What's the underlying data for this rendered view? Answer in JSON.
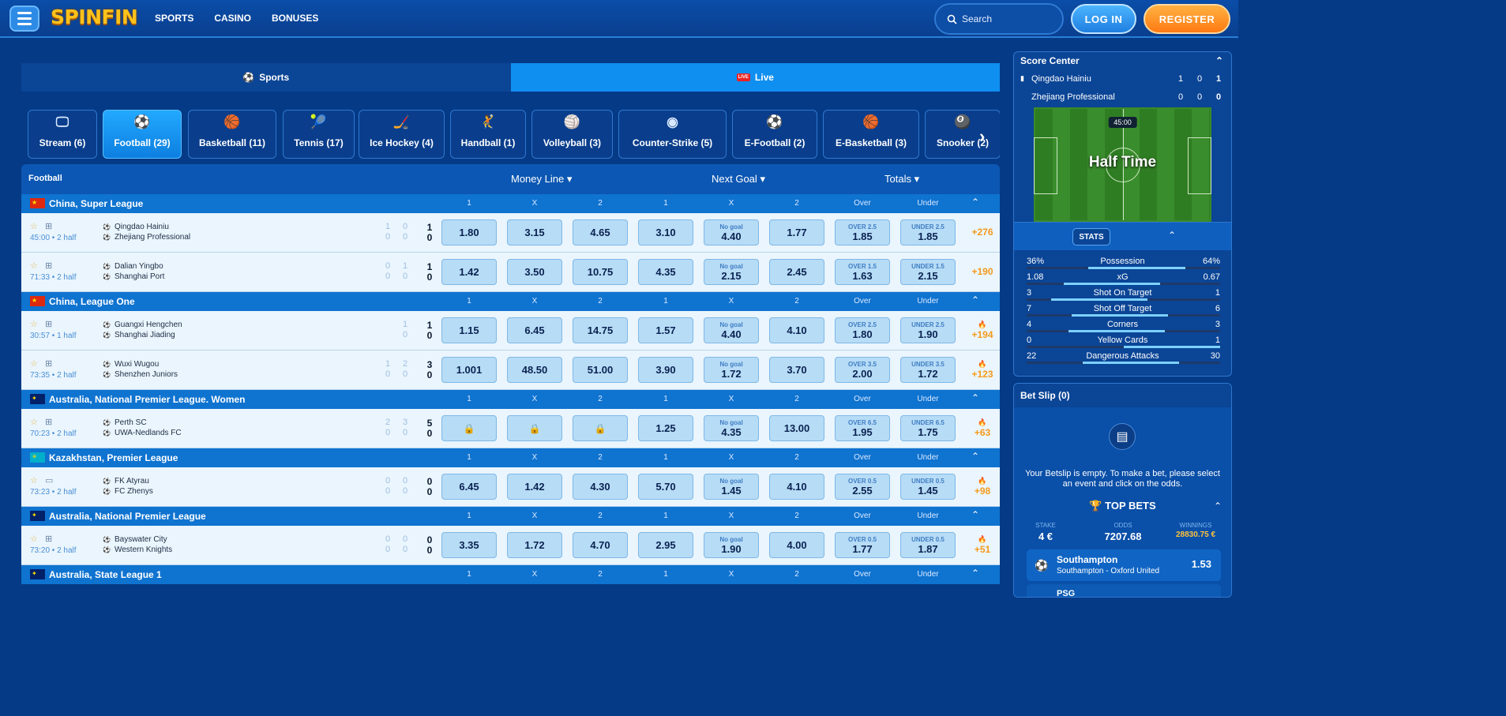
{
  "header": {
    "logo": "SPINFIN",
    "nav": [
      "SPORTS",
      "CASINO",
      "BONUSES"
    ],
    "search_placeholder": "Search",
    "login": "LOG IN",
    "register": "REGISTER"
  },
  "top_tabs": [
    {
      "label": "Sports",
      "active": false
    },
    {
      "label": "Live",
      "active": true
    }
  ],
  "live_badge": "LIVE",
  "sport_tabs": [
    {
      "icon": "monitor-icon",
      "glyph": "🖵",
      "label": "Stream (6)"
    },
    {
      "icon": "football-icon",
      "glyph": "⚽",
      "label": "Football (29)",
      "active": true
    },
    {
      "icon": "basketball-icon",
      "glyph": "🏀",
      "label": "Basketball (11)"
    },
    {
      "icon": "tennis-icon",
      "glyph": "🎾",
      "label": "Tennis (17)"
    },
    {
      "icon": "ice-hockey-icon",
      "glyph": "🏒",
      "label": "Ice Hockey (4)"
    },
    {
      "icon": "handball-icon",
      "glyph": "🤾",
      "label": "Handball (1)"
    },
    {
      "icon": "volleyball-icon",
      "glyph": "🏐",
      "label": "Volleyball (3)"
    },
    {
      "icon": "counter-strike-icon",
      "glyph": "◉",
      "label": "Counter-Strike (5)"
    },
    {
      "icon": "e-football-icon",
      "glyph": "⚽",
      "label": "E-Football (2)"
    },
    {
      "icon": "e-basketball-icon",
      "glyph": "🏀",
      "label": "E-Basketball (3)"
    },
    {
      "icon": "snooker-icon",
      "glyph": "🎱",
      "label": "Snooker (2)"
    }
  ],
  "table": {
    "title": "Football",
    "groups": [
      "Money Line",
      "Next Goal",
      "Totals"
    ],
    "leagues": [
      {
        "name": "China, Super League",
        "flag": "cn",
        "cols": [
          "1",
          "X",
          "2",
          "1",
          "X",
          "2",
          "Over",
          "Under"
        ],
        "matches": [
          {
            "time": "45:00 • 2 half",
            "cam": true,
            "home": "Qingdao Hainiu",
            "away": "Zhejiang Professional",
            "p1": [
              "1",
              "0"
            ],
            "p2": [
              "0",
              "0"
            ],
            "score": [
              "1",
              "0"
            ],
            "odds": [
              "1.80",
              "3.15",
              "4.65",
              "3.10",
              "4.40",
              "1.77",
              "1.85",
              "1.85"
            ],
            "ng_label": "No goal",
            "over_label": "OVER 2.5",
            "under_label": "UNDER 2.5",
            "more": "+276",
            "hot": false
          },
          {
            "time": "71:33 • 2 half",
            "cam": true,
            "home": "Dalian Yingbo",
            "away": "Shanghai Port",
            "p1": [
              "0",
              "0"
            ],
            "p2": [
              "1",
              "0"
            ],
            "score": [
              "1",
              "0"
            ],
            "odds": [
              "1.42",
              "3.50",
              "10.75",
              "4.35",
              "2.15",
              "2.45",
              "1.63",
              "2.15"
            ],
            "ng_label": "No goal",
            "over_label": "OVER 1.5",
            "under_label": "UNDER 1.5",
            "more": "+190",
            "hot": false
          }
        ]
      },
      {
        "name": "China, League One",
        "flag": "cn",
        "cols": [
          "1",
          "X",
          "2",
          "1",
          "X",
          "2",
          "Over",
          "Under"
        ],
        "matches": [
          {
            "time": "30:57 • 1 half",
            "cam": true,
            "home": "Guangxi Hengchen",
            "away": "Shanghai Jiading",
            "p1": [
              "",
              ""
            ],
            "p2": [
              "1",
              "0"
            ],
            "score": [
              "1",
              "0"
            ],
            "odds": [
              "1.15",
              "6.45",
              "14.75",
              "1.57",
              "4.40",
              "4.10",
              "1.80",
              "1.90"
            ],
            "ng_label": "No goal",
            "over_label": "OVER 2.5",
            "under_label": "UNDER 2.5",
            "more": "+194",
            "hot": true
          },
          {
            "time": "73:35 • 2 half",
            "cam": true,
            "home": "Wuxi Wugou",
            "away": "Shenzhen Juniors",
            "p1": [
              "1",
              "0"
            ],
            "p2": [
              "2",
              "0"
            ],
            "score": [
              "3",
              "0"
            ],
            "odds": [
              "1.001",
              "48.50",
              "51.00",
              "3.90",
              "1.72",
              "3.70",
              "2.00",
              "1.72"
            ],
            "ng_label": "No goal",
            "over_label": "OVER 3.5",
            "under_label": "UNDER 3.5",
            "more": "+123",
            "hot": true
          }
        ]
      },
      {
        "name": "Australia, National Premier League. Women",
        "flag": "au",
        "cols": [
          "1",
          "X",
          "2",
          "1",
          "X",
          "2",
          "Over",
          "Under"
        ],
        "matches": [
          {
            "time": "70:23 • 2 half",
            "cam": true,
            "home": "Perth SC",
            "away": "UWA-Nedlands FC",
            "p1": [
              "2",
              "0"
            ],
            "p2": [
              "3",
              "0"
            ],
            "score": [
              "5",
              "0"
            ],
            "odds": [
              "lock",
              "lock",
              "lock",
              "1.25",
              "4.35",
              "13.00",
              "1.95",
              "1.75"
            ],
            "ng_label": "No goal",
            "over_label": "OVER 6.5",
            "under_label": "UNDER 6.5",
            "more": "+63",
            "hot": true
          }
        ]
      },
      {
        "name": "Kazakhstan, Premier League",
        "flag": "kz",
        "cols": [
          "1",
          "X",
          "2",
          "1",
          "X",
          "2",
          "Over",
          "Under"
        ],
        "matches": [
          {
            "time": "73:23 • 2 half",
            "cam": false,
            "home": "FK Atyrau",
            "away": "FC Zhenys",
            "p1": [
              "0",
              "0"
            ],
            "p2": [
              "0",
              "0"
            ],
            "score": [
              "0",
              "0"
            ],
            "odds": [
              "6.45",
              "1.42",
              "4.30",
              "5.70",
              "1.45",
              "4.10",
              "2.55",
              "1.45"
            ],
            "ng_label": "No goal",
            "over_label": "OVER 0.5",
            "under_label": "UNDER 0.5",
            "more": "+98",
            "hot": true
          }
        ]
      },
      {
        "name": "Australia, National Premier League",
        "flag": "au",
        "cols": [
          "1",
          "X",
          "2",
          "1",
          "X",
          "2",
          "Over",
          "Under"
        ],
        "matches": [
          {
            "time": "73:20 • 2 half",
            "cam": true,
            "home": "Bayswater City",
            "away": "Western Knights",
            "p1": [
              "0",
              "0"
            ],
            "p2": [
              "0",
              "0"
            ],
            "score": [
              "0",
              "0"
            ],
            "odds": [
              "3.35",
              "1.72",
              "4.70",
              "2.95",
              "1.90",
              "4.00",
              "1.77",
              "1.87"
            ],
            "ng_label": "No goal",
            "over_label": "OVER 0.5",
            "under_label": "UNDER 0.5",
            "more": "+51",
            "hot": true
          }
        ]
      },
      {
        "name": "Australia, State League 1",
        "flag": "au",
        "cols": [
          "1",
          "X",
          "2",
          "1",
          "X",
          "2",
          "Over",
          "Under"
        ],
        "matches": []
      }
    ]
  },
  "score_center": {
    "title": "Score Center",
    "teams": [
      {
        "name": "Qingdao Hainiu",
        "s": [
          "1",
          "0",
          "1"
        ]
      },
      {
        "name": "Zhejiang Professional",
        "s": [
          "0",
          "0",
          "0"
        ]
      }
    ],
    "clock": "45:00",
    "status": "Half Time",
    "stats_label": "STATS",
    "stats": [
      {
        "l": "36%",
        "name": "Possession",
        "r": "64%",
        "lv": 36,
        "rv": 64
      },
      {
        "l": "1.08",
        "name": "xG",
        "r": "0.67",
        "lv": 1.08,
        "rv": 0.67
      },
      {
        "l": "3",
        "name": "Shot On Target",
        "r": "1",
        "lv": 3,
        "rv": 1
      },
      {
        "l": "7",
        "name": "Shot Off Target",
        "r": "6",
        "lv": 7,
        "rv": 6
      },
      {
        "l": "4",
        "name": "Corners",
        "r": "3",
        "lv": 4,
        "rv": 3
      },
      {
        "l": "0",
        "name": "Yellow Cards",
        "r": "1",
        "lv": 0,
        "rv": 1
      },
      {
        "l": "22",
        "name": "Dangerous Attacks",
        "r": "30",
        "lv": 22,
        "rv": 30
      }
    ]
  },
  "bet_slip": {
    "title": "Bet Slip (0)",
    "empty_msg": "Your Betslip is empty. To make a bet, please select an event and click on the odds.",
    "top_bets": "TOP BETS",
    "stake_label": "STAKE",
    "stake": "4 €",
    "odds_label": "ODDS",
    "odds": "7207.68",
    "win_label": "WINNINGS",
    "win": "28830.75 €",
    "bets": [
      {
        "title": "Southampton",
        "sub": "Southampton - Oxford United",
        "odd": "1.53"
      },
      {
        "title": "PSG"
      }
    ]
  },
  "colors": {
    "accent": "#0f8ff0",
    "odds_bg": "#b7dcf6",
    "more": "#f59a1b",
    "register": "#ff8a1f"
  }
}
